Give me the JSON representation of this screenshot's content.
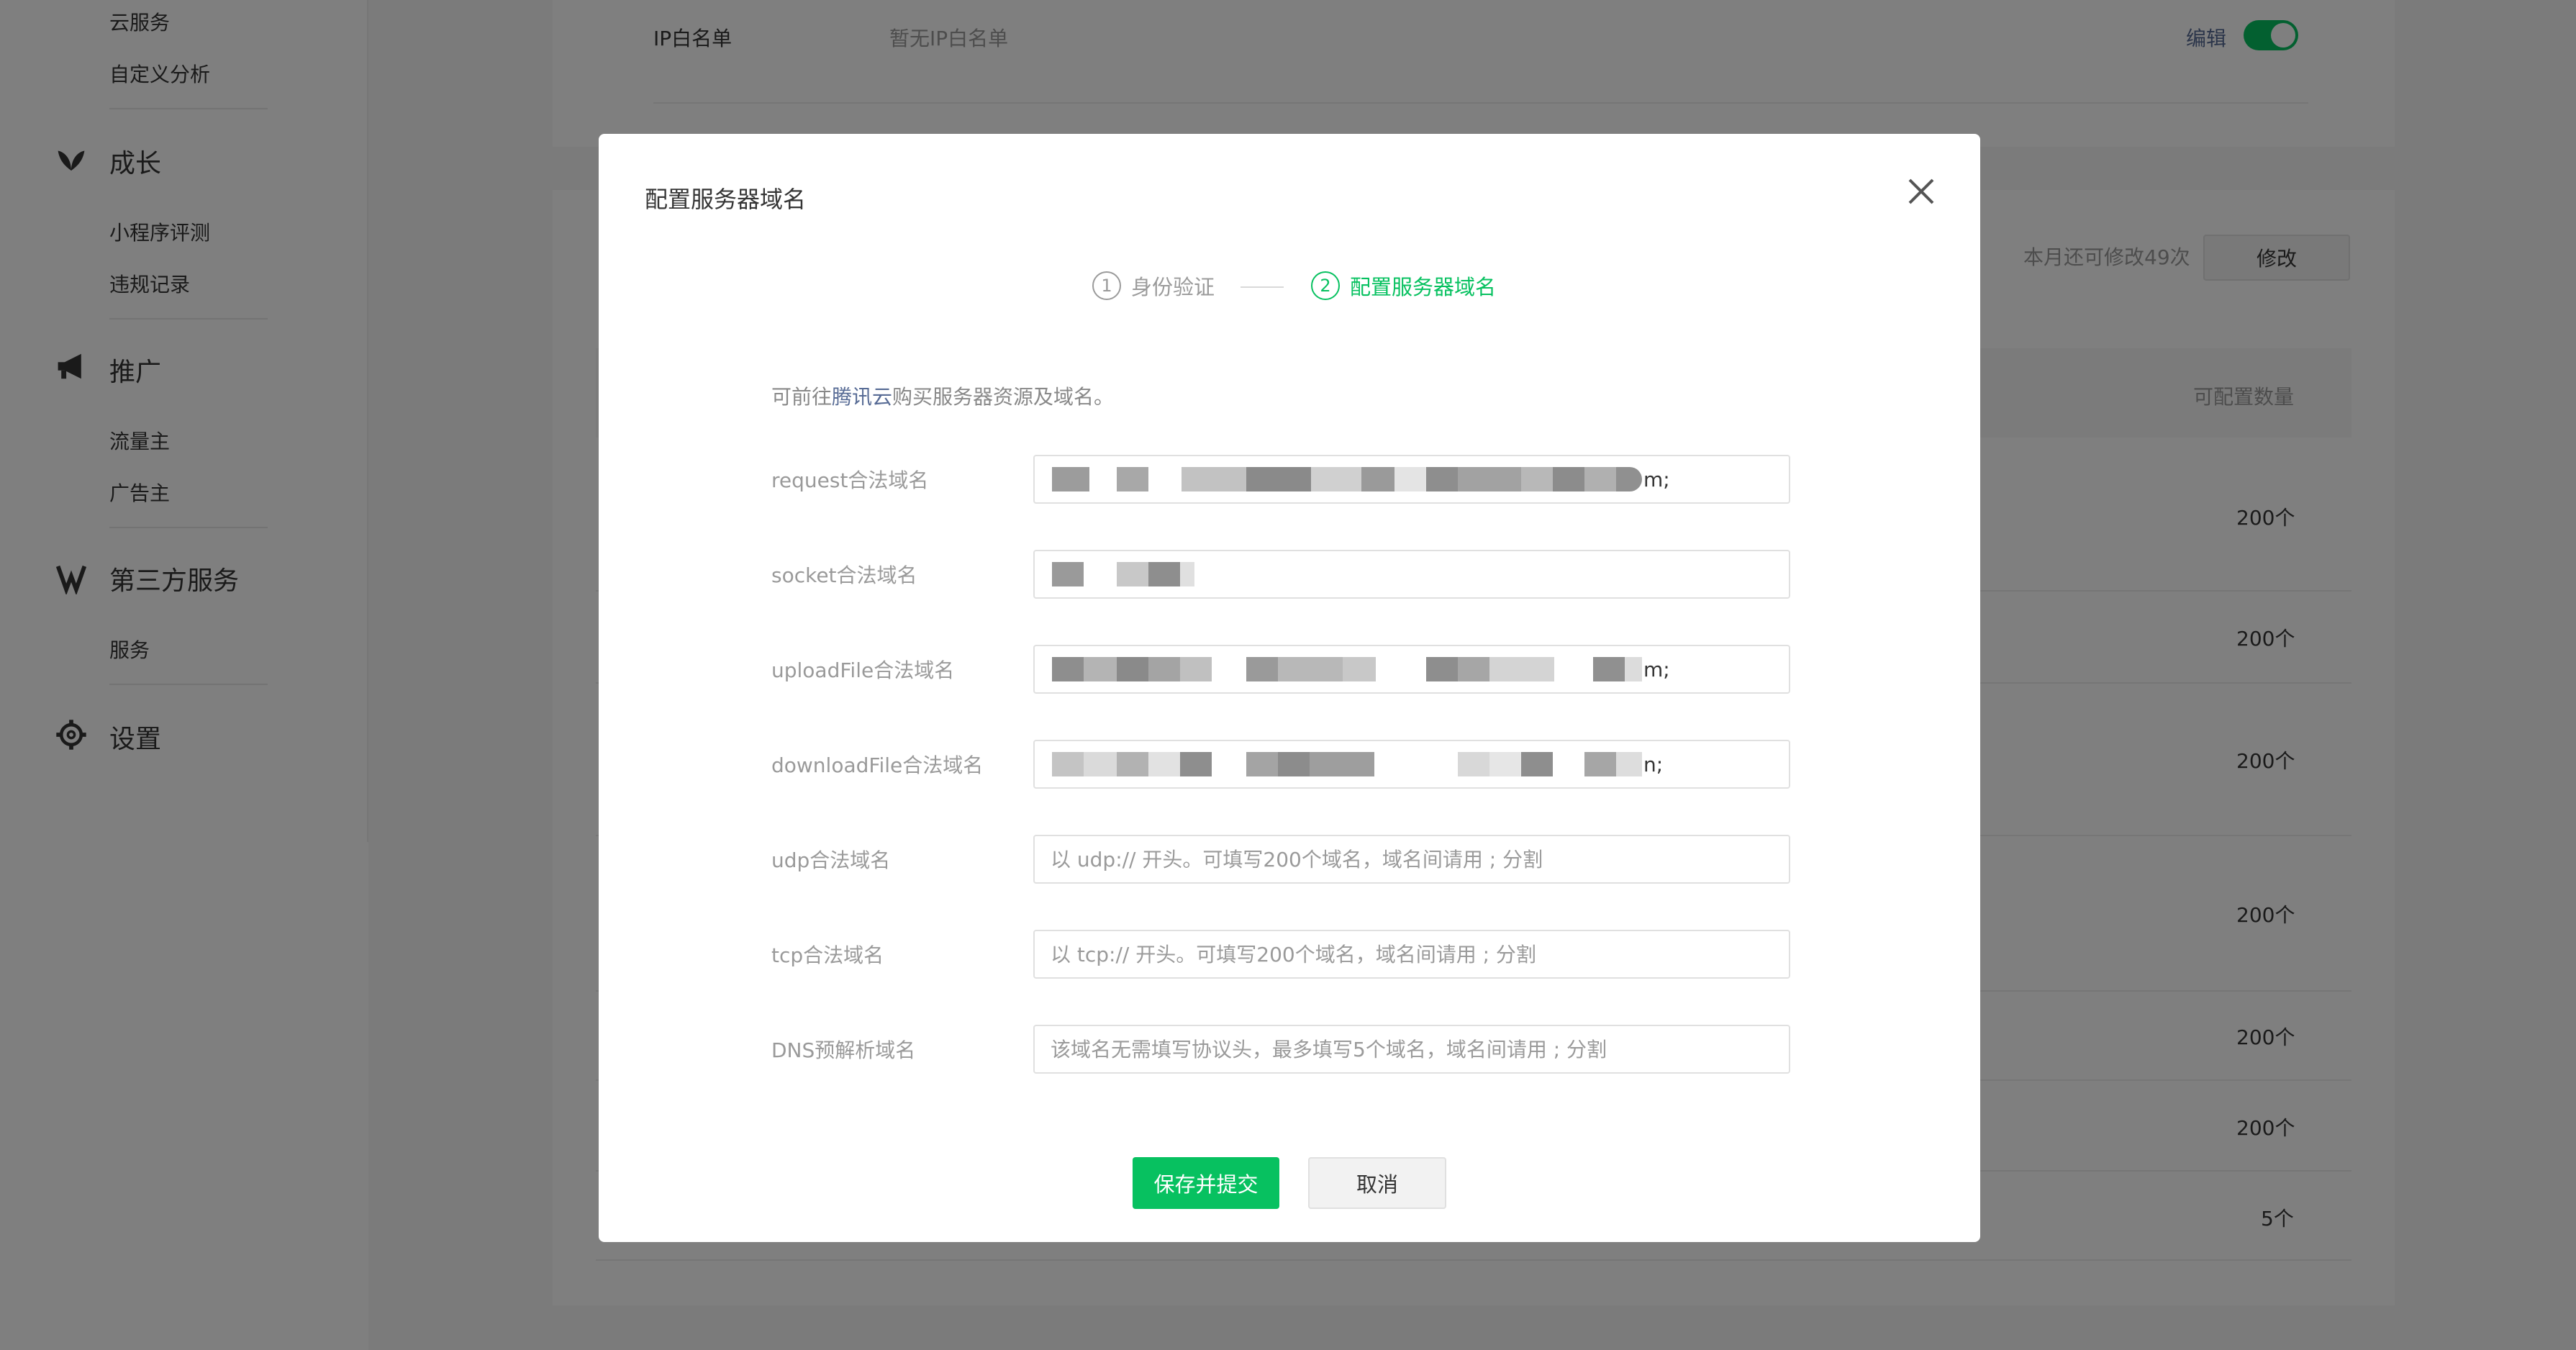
{
  "sidebar": {
    "top_items": [
      "云服务",
      "自定义分析"
    ],
    "groups": [
      {
        "title": "成长",
        "icon": "leaf-icon",
        "items": [
          "小程序评测",
          "违规记录"
        ]
      },
      {
        "title": "推广",
        "icon": "megaphone-icon",
        "items": [
          "流量主",
          "广告主"
        ]
      },
      {
        "title": "第三方服务",
        "icon": "third-party-icon",
        "items": [
          "服务"
        ]
      },
      {
        "title": "设置",
        "icon": "gear-icon",
        "items": []
      }
    ]
  },
  "background": {
    "ip_whitelist_label": "IP白名单",
    "ip_whitelist_value": "暂无IP白名单",
    "edit_link": "编辑",
    "monthly_remaining": "本月还可修改49次",
    "modify_button": "修改",
    "column_header": "可配置数量",
    "counts": [
      "200个",
      "200个",
      "200个",
      "200个",
      "200个",
      "200个",
      "5个"
    ]
  },
  "dialog": {
    "title": "配置服务器域名",
    "steps": [
      {
        "num": "1",
        "label": "身份验证"
      },
      {
        "num": "2",
        "label": "配置服务器域名"
      }
    ],
    "intro_prefix": "可前往",
    "intro_link": "腾讯云",
    "intro_suffix": "购买服务器资源及域名。",
    "fields": {
      "request": {
        "label": "request合法域名",
        "tail": "m;"
      },
      "socket": {
        "label": "socket合法域名"
      },
      "upload": {
        "label": "uploadFile合法域名",
        "tail": "m;"
      },
      "download": {
        "label": "downloadFile合法域名",
        "tail": "n;"
      },
      "udp": {
        "label": "udp合法域名",
        "placeholder": "以 udp:// 开头。可填写200个域名，域名间请用 ; 分割"
      },
      "tcp": {
        "label": "tcp合法域名",
        "placeholder": "以 tcp:// 开头。可填写200个域名，域名间请用 ; 分割"
      },
      "dns": {
        "label": "DNS预解析域名",
        "placeholder": "该域名无需填写协议头，最多填写5个域名，域名间请用 ; 分割"
      }
    },
    "save_button": "保存并提交",
    "cancel_button": "取消"
  },
  "colors": {
    "accent": "#07c160",
    "link": "#576b95",
    "mask": "rgba(0,0,0,0.5)"
  }
}
